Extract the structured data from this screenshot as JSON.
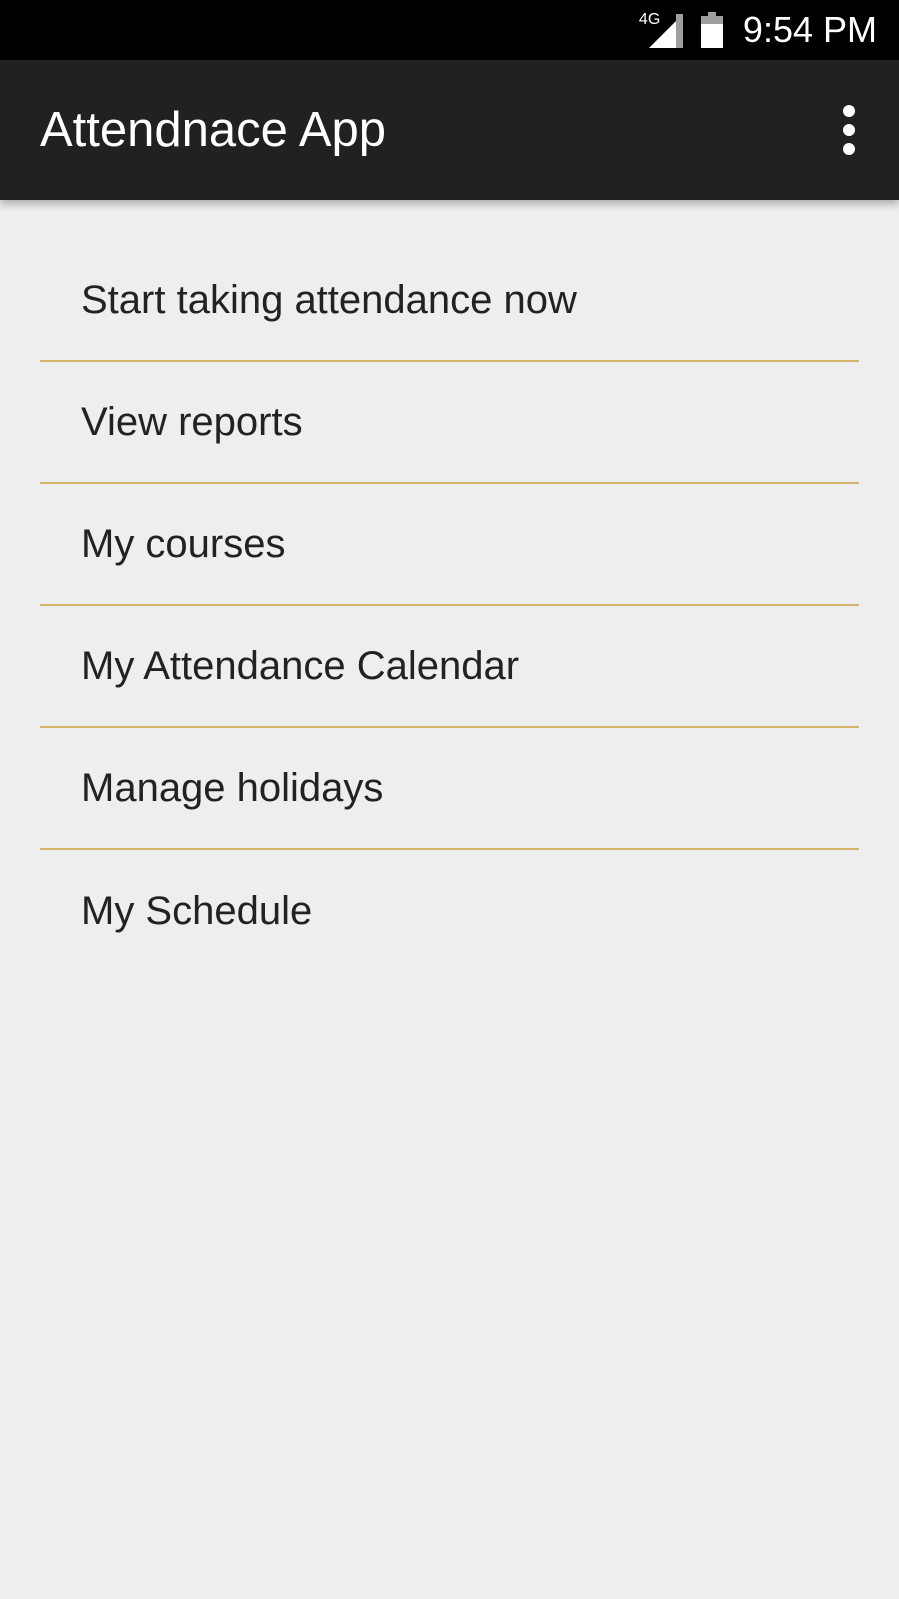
{
  "status_bar": {
    "network_label": "4G",
    "time": "9:54 PM",
    "icons": [
      "signal-icon",
      "battery-icon"
    ]
  },
  "app_bar": {
    "title": "Attendnace App",
    "menu_icon": "overflow-menu-icon"
  },
  "menu": {
    "items": [
      {
        "label": "Start taking attendance now"
      },
      {
        "label": "View reports"
      },
      {
        "label": "My courses"
      },
      {
        "label": "My Attendance Calendar"
      },
      {
        "label": "Manage holidays"
      },
      {
        "label": "My Schedule"
      }
    ]
  },
  "colors": {
    "status_bar": "#000000",
    "app_bar": "#212121",
    "background": "#eeeeee",
    "divider": "#d4b468",
    "text": "#222222"
  }
}
